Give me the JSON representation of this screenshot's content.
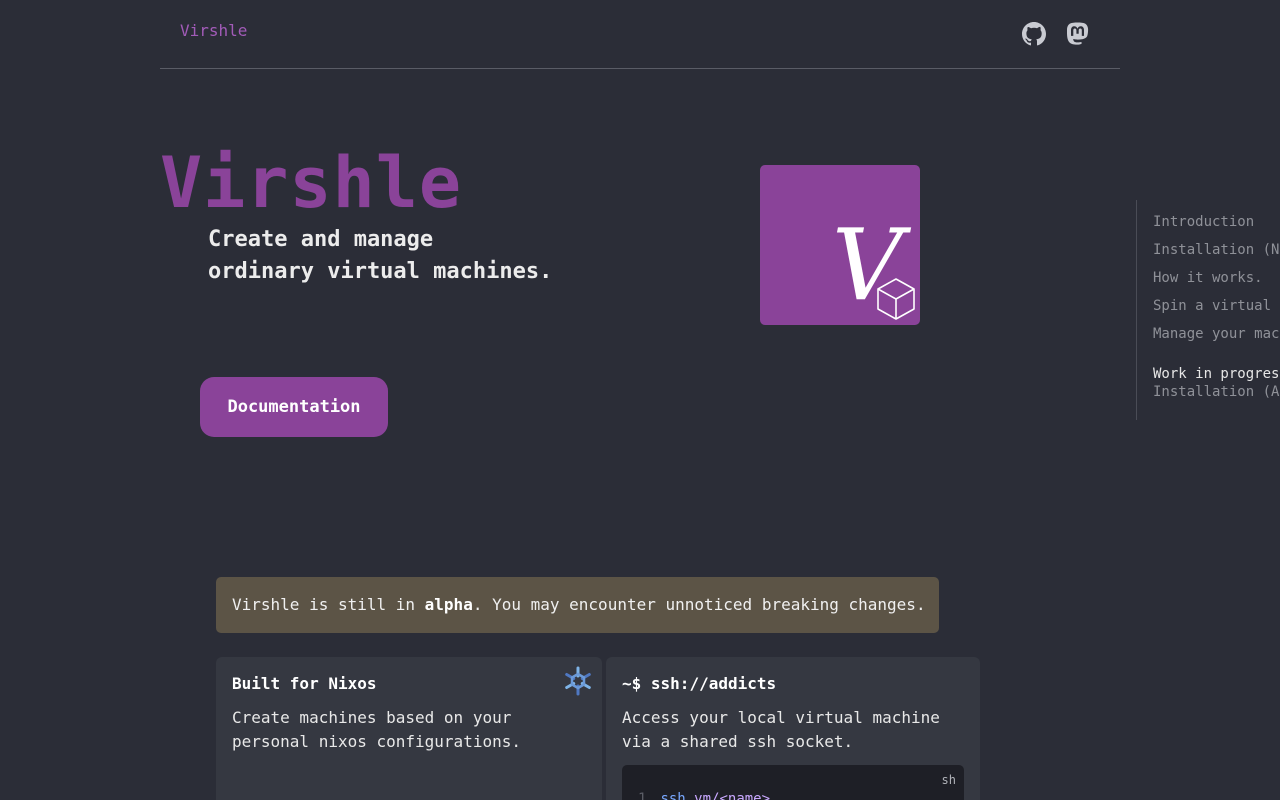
{
  "header": {
    "brand": "Virshle",
    "icons": [
      "github-icon",
      "mastodon-icon"
    ]
  },
  "hero": {
    "title": "Virshle",
    "tagline_line1": "Create and manage",
    "tagline_line2": "ordinary virtual machines.",
    "logo_letter": "V",
    "cta_label": "Documentation"
  },
  "toc": {
    "items": [
      "Introduction",
      "Installation (N",
      "How it works.",
      "Spin a virtual",
      "Manage your mac"
    ],
    "heading": "Work in progres",
    "sub_items": [
      "Installation (A"
    ]
  },
  "alert": {
    "prefix": "Virshle is still in ",
    "bold": "alpha",
    "suffix": ". You may encounter unnoticed breaking changes."
  },
  "cards": {
    "nixos": {
      "title": "Built for Nixos",
      "text_line1": "Create machines based on your",
      "text_line2": "personal nixos configurations."
    },
    "ssh": {
      "title_prefix": "~$ ",
      "title_bold": "ssh://addicts",
      "text_line1": "Access your local virtual machine",
      "text_line2": "via a shared ssh socket.",
      "code_lang": "sh",
      "code_line_number": "1",
      "code_cmd": "ssh",
      "code_arg": "vm/<name>"
    }
  },
  "colors": {
    "background": "#2b2d37",
    "accent": "#8a4399",
    "brand_link": "#a25bb8",
    "alert_bg": "#5c5446",
    "card_bg": "#353841"
  }
}
